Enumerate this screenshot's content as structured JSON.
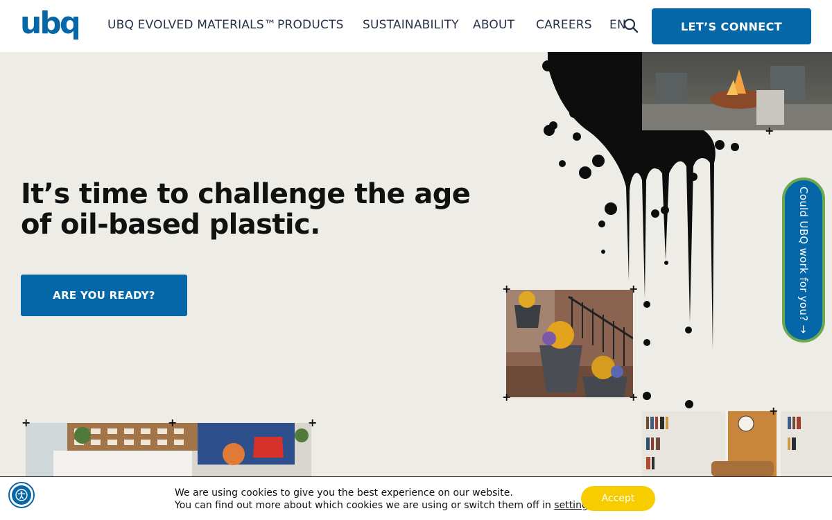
{
  "header": {
    "logo_text": "ubq",
    "nav": [
      {
        "label": "UBQ EVOLVED MATERIALS™"
      },
      {
        "label": "PRODUCTS"
      },
      {
        "label": "SUSTAINABILITY"
      },
      {
        "label": "ABOUT"
      },
      {
        "label": "CAREERS"
      },
      {
        "label": "EN"
      }
    ],
    "search_icon": "search-icon",
    "cta_label": "LET’S CONNECT"
  },
  "hero": {
    "title": "It’s time to challenge the age of oil-based plastic.",
    "button_label": "ARE YOU READY?"
  },
  "side_tab": {
    "label": "Could UBQ work for you? →"
  },
  "cookie": {
    "line1": "We are using cookies to give you the best experience on our website.",
    "line2_prefix": "You can find out more about which cookies we are using or switch them off in ",
    "line2_link": "settings",
    "line2_suffix": ".",
    "accept_label": "Accept"
  },
  "accessibility": {
    "icon": "accessibility-icon"
  },
  "colors": {
    "brand_blue": "#0567a8",
    "background": "#edece6",
    "accept_yellow": "#f7cd00",
    "tab_border_green": "#6aa84f"
  }
}
